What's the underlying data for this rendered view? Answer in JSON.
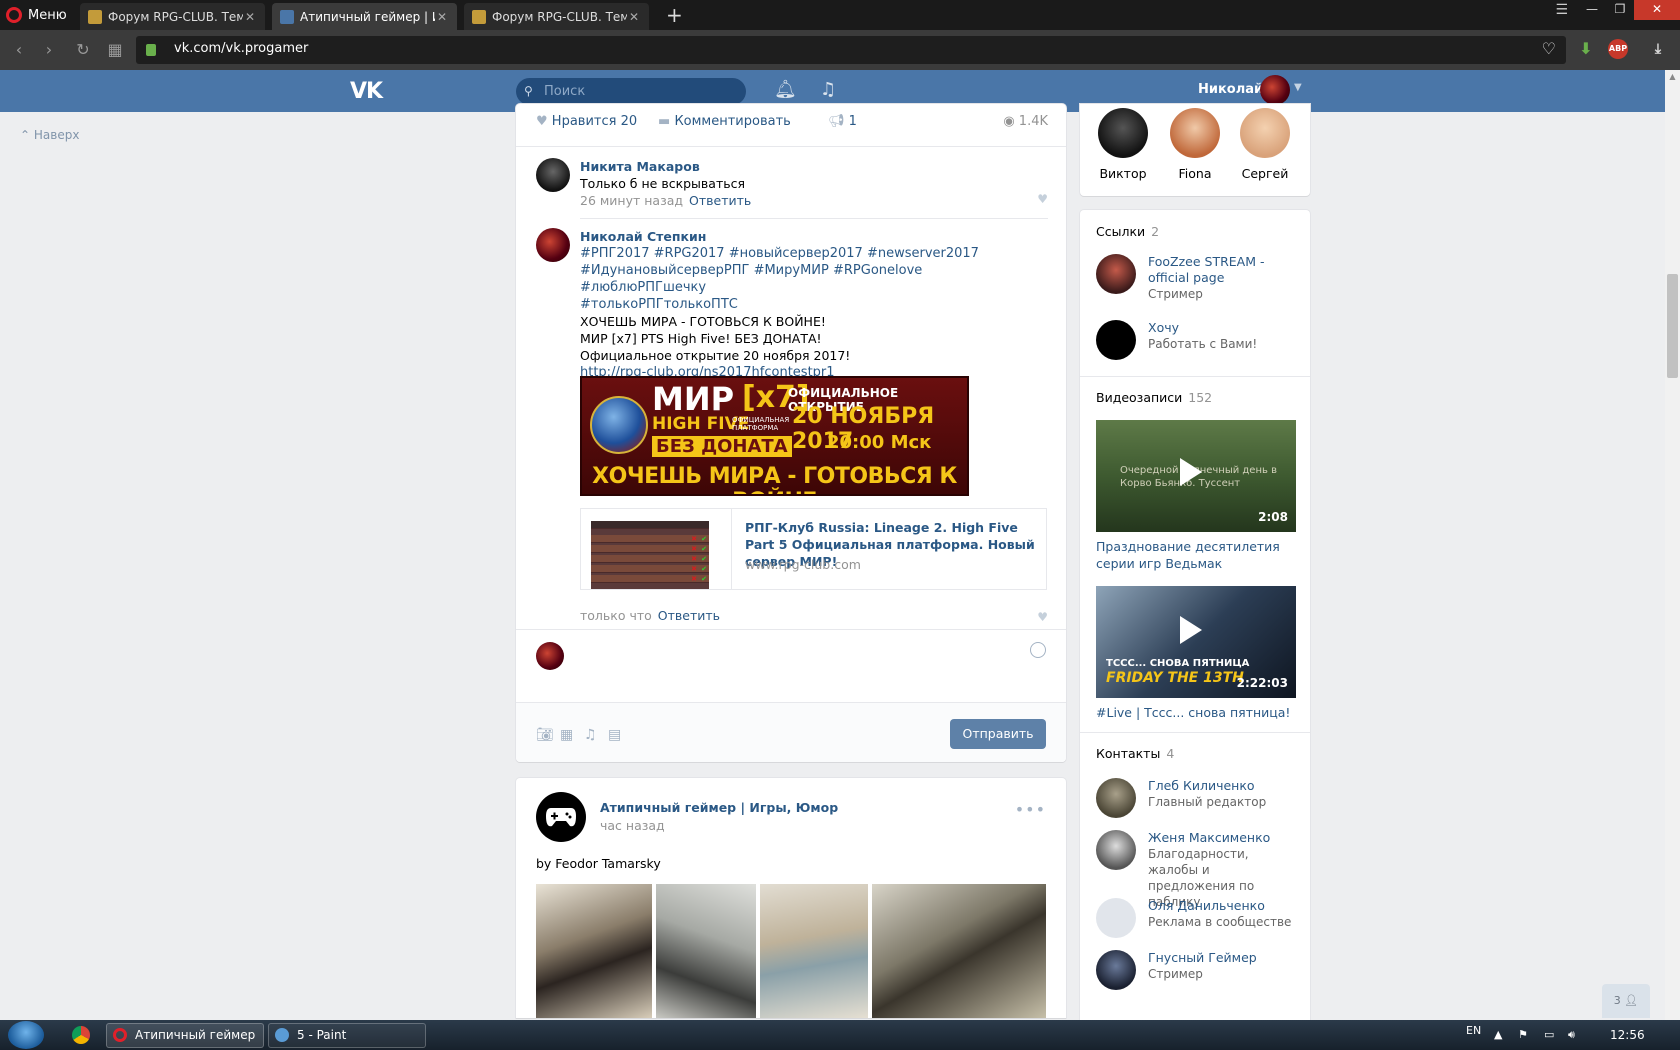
{
  "browser": {
    "menu_label": "Меню",
    "tabs": [
      {
        "title": "Форум RPG-CLUB. Тема: R"
      },
      {
        "title": "Атипичный геймер | Игры"
      },
      {
        "title": "Форум RPG-CLUB. Тема: R"
      }
    ],
    "url": "vk.com/vk.progamer",
    "abp": "ABP"
  },
  "vk_header": {
    "logo": "VK",
    "search_placeholder": "Поиск",
    "user_name": "Николай"
  },
  "back_to_top": "Наверх",
  "post_actions": {
    "like_label": "Нравится",
    "like_count": "20",
    "comment_label": "Комментировать",
    "share_count": "1",
    "views": "1.4K"
  },
  "comments": [
    {
      "author": "Никита Макаров",
      "text": "Только б не вскрываться",
      "time": "26 минут назад",
      "reply": "Ответить"
    },
    {
      "author": "Николай Степкин",
      "hashtags_1": "#РПГ2017 #RPG2017 #новыйсервер2017 #newserver2017",
      "hashtags_2": "#ИдунановыйсерверРПГ #МируМИР #RPGonelove #люблюРПГшечку",
      "hashtags_3": "#толькоРПГтолькоПТС",
      "line_1": "ХОЧЕШЬ МИРА - ГОТОВЬСЯ К ВОЙНЕ!",
      "line_2": "МИР [x7] PTS High Five! БЕЗ ДОНАТА!",
      "line_3": "Официальное открытие 20 ноября 2017!",
      "link": "http://rpg-club.org/ns2017hfcontestpr1",
      "time": "только что",
      "reply": "Ответить"
    }
  ],
  "banner": {
    "mir": "МИР",
    "x7": "[x7]",
    "high_five": "HIGH FIVE",
    "official_platform": "ОФИЦИАЛЬНАЯ ПЛАТФОРМА",
    "no_donate": "БЕЗ ДОНАТА",
    "opening": "ОФИЦИАЛЬНОЕ ОТКРЫТИЕ",
    "date": "20 НОЯБРЯ 2017",
    "time": "20:00 Мск",
    "slogan": "ХОЧЕШЬ МИРА - ГОТОВЬСЯ К ВОЙНЕ"
  },
  "link_card": {
    "title": "РПГ-Клуб Russia: Lineage 2. High Five Part 5 Официальная платформа. Новый сервер МИР!",
    "domain": "www.rpg-club.com"
  },
  "send_button": "Отправить",
  "post2": {
    "author": "Атипичный геймер | Игры, Юмор",
    "time": "час назад",
    "text": "by Feodor Tamarsky"
  },
  "friends": [
    {
      "name": "Виктор"
    },
    {
      "name": "Fiona"
    },
    {
      "name": "Сергей"
    }
  ],
  "links_block": {
    "title": "Ссылки",
    "count": "2",
    "items": [
      {
        "name": "FooZzee STREAM - official page",
        "sub": "Стример"
      },
      {
        "name": "Хочу",
        "sub": "Работать с Вами!"
      }
    ]
  },
  "videos_block": {
    "title": "Видеозаписи",
    "count": "152",
    "items": [
      {
        "duration": "2:08",
        "title": "Празднование десятилетия серии игр Ведьмак",
        "overlay": "Очередной солнечный день в Корво Бьянко. Туссент"
      },
      {
        "duration": "2:22:03",
        "title": "#Live | Тссс... снова пятница!",
        "overlay": "FRIDAY THE 13TH",
        "overlay_top": "ТССС... СНОВА ПЯТНИЦА"
      }
    ]
  },
  "contacts_block": {
    "title": "Контакты",
    "count": "4",
    "items": [
      {
        "name": "Глеб Киличенко",
        "sub": "Главный редактор"
      },
      {
        "name": "Женя Максименко",
        "sub": "Благодарности, жалобы и предложения по паблику"
      },
      {
        "name": "Оля Данильченко",
        "sub": "Реклама в сообществе"
      },
      {
        "name": "Гнусный Геймер",
        "sub": "Стример"
      }
    ]
  },
  "chat_count": "3",
  "taskbar": {
    "items": [
      {
        "label": "Атипичный геймер ..."
      },
      {
        "label": "5 - Paint"
      }
    ],
    "lang": "EN",
    "clock": "12:56"
  }
}
